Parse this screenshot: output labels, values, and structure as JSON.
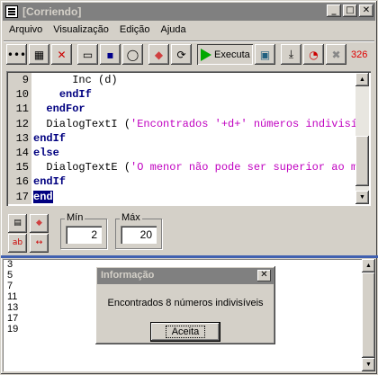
{
  "window": {
    "title": "[Corriendo]"
  },
  "title_buttons": {
    "minimize": "_",
    "maximize": "□",
    "close": "✕"
  },
  "menu": [
    "Arquivo",
    "Visualização",
    "Edição",
    "Ajuda"
  ],
  "toolbar": {
    "exec_label": "Executa",
    "counter": "326"
  },
  "editor": {
    "line_numbers": [
      "9",
      "10",
      "11",
      "12",
      "13",
      "14",
      "15",
      "16",
      "17"
    ],
    "lines": [
      {
        "indent": "      ",
        "kw": "",
        "text": "Inc (d)",
        "str": ""
      },
      {
        "indent": "    ",
        "kw": "endIf",
        "text": "",
        "str": ""
      },
      {
        "indent": "  ",
        "kw": "endFor",
        "text": "",
        "str": ""
      },
      {
        "indent": "  ",
        "kw": "",
        "text": "DialogTextI (",
        "str": "'Encontrados '+d+' números indivisíveis'"
      },
      {
        "indent": "",
        "kw": "endIf",
        "text": "",
        "str": ""
      },
      {
        "indent": "",
        "kw": "else",
        "text": "",
        "str": ""
      },
      {
        "indent": "  ",
        "kw": "",
        "text": "DialogTextE (",
        "str": "'O menor não pode ser superior ao maior'"
      },
      {
        "indent": "",
        "kw": "endIf",
        "text": "",
        "str": ""
      },
      {
        "indent": "",
        "kw": "end",
        "text": "",
        "str": "",
        "selected": true
      }
    ]
  },
  "params": {
    "min_label": "Mín",
    "min_value": "2",
    "max_label": "Máx",
    "max_value": "20"
  },
  "output": [
    "3",
    "5",
    "7",
    "11",
    "13",
    "17",
    "19"
  ],
  "dialog": {
    "title": "Informação",
    "message": "Encontrados 8 números indivisíveis",
    "ok_label": "Aceita"
  }
}
